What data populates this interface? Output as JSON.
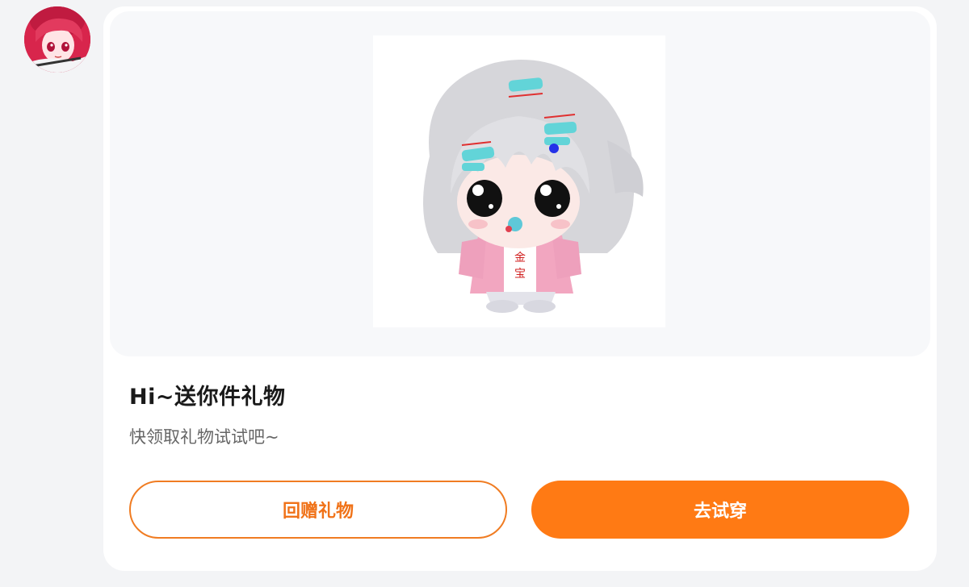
{
  "sender": {
    "avatar_icon": "anime-girl-avatar"
  },
  "gift_card": {
    "image_icon": "chibi-avatar-outfit-image",
    "title": "Hi~送你件礼物",
    "subtitle": "快领取礼物试试吧~",
    "buttons": {
      "return_gift_label": "回赠礼物",
      "try_on_label": "去试穿"
    }
  },
  "colors": {
    "accent": "#ff7a14",
    "accent_border": "#f07c22",
    "page_bg": "#f3f4f6",
    "card_bg": "#ffffff",
    "preview_bg": "#f7f8fa"
  }
}
